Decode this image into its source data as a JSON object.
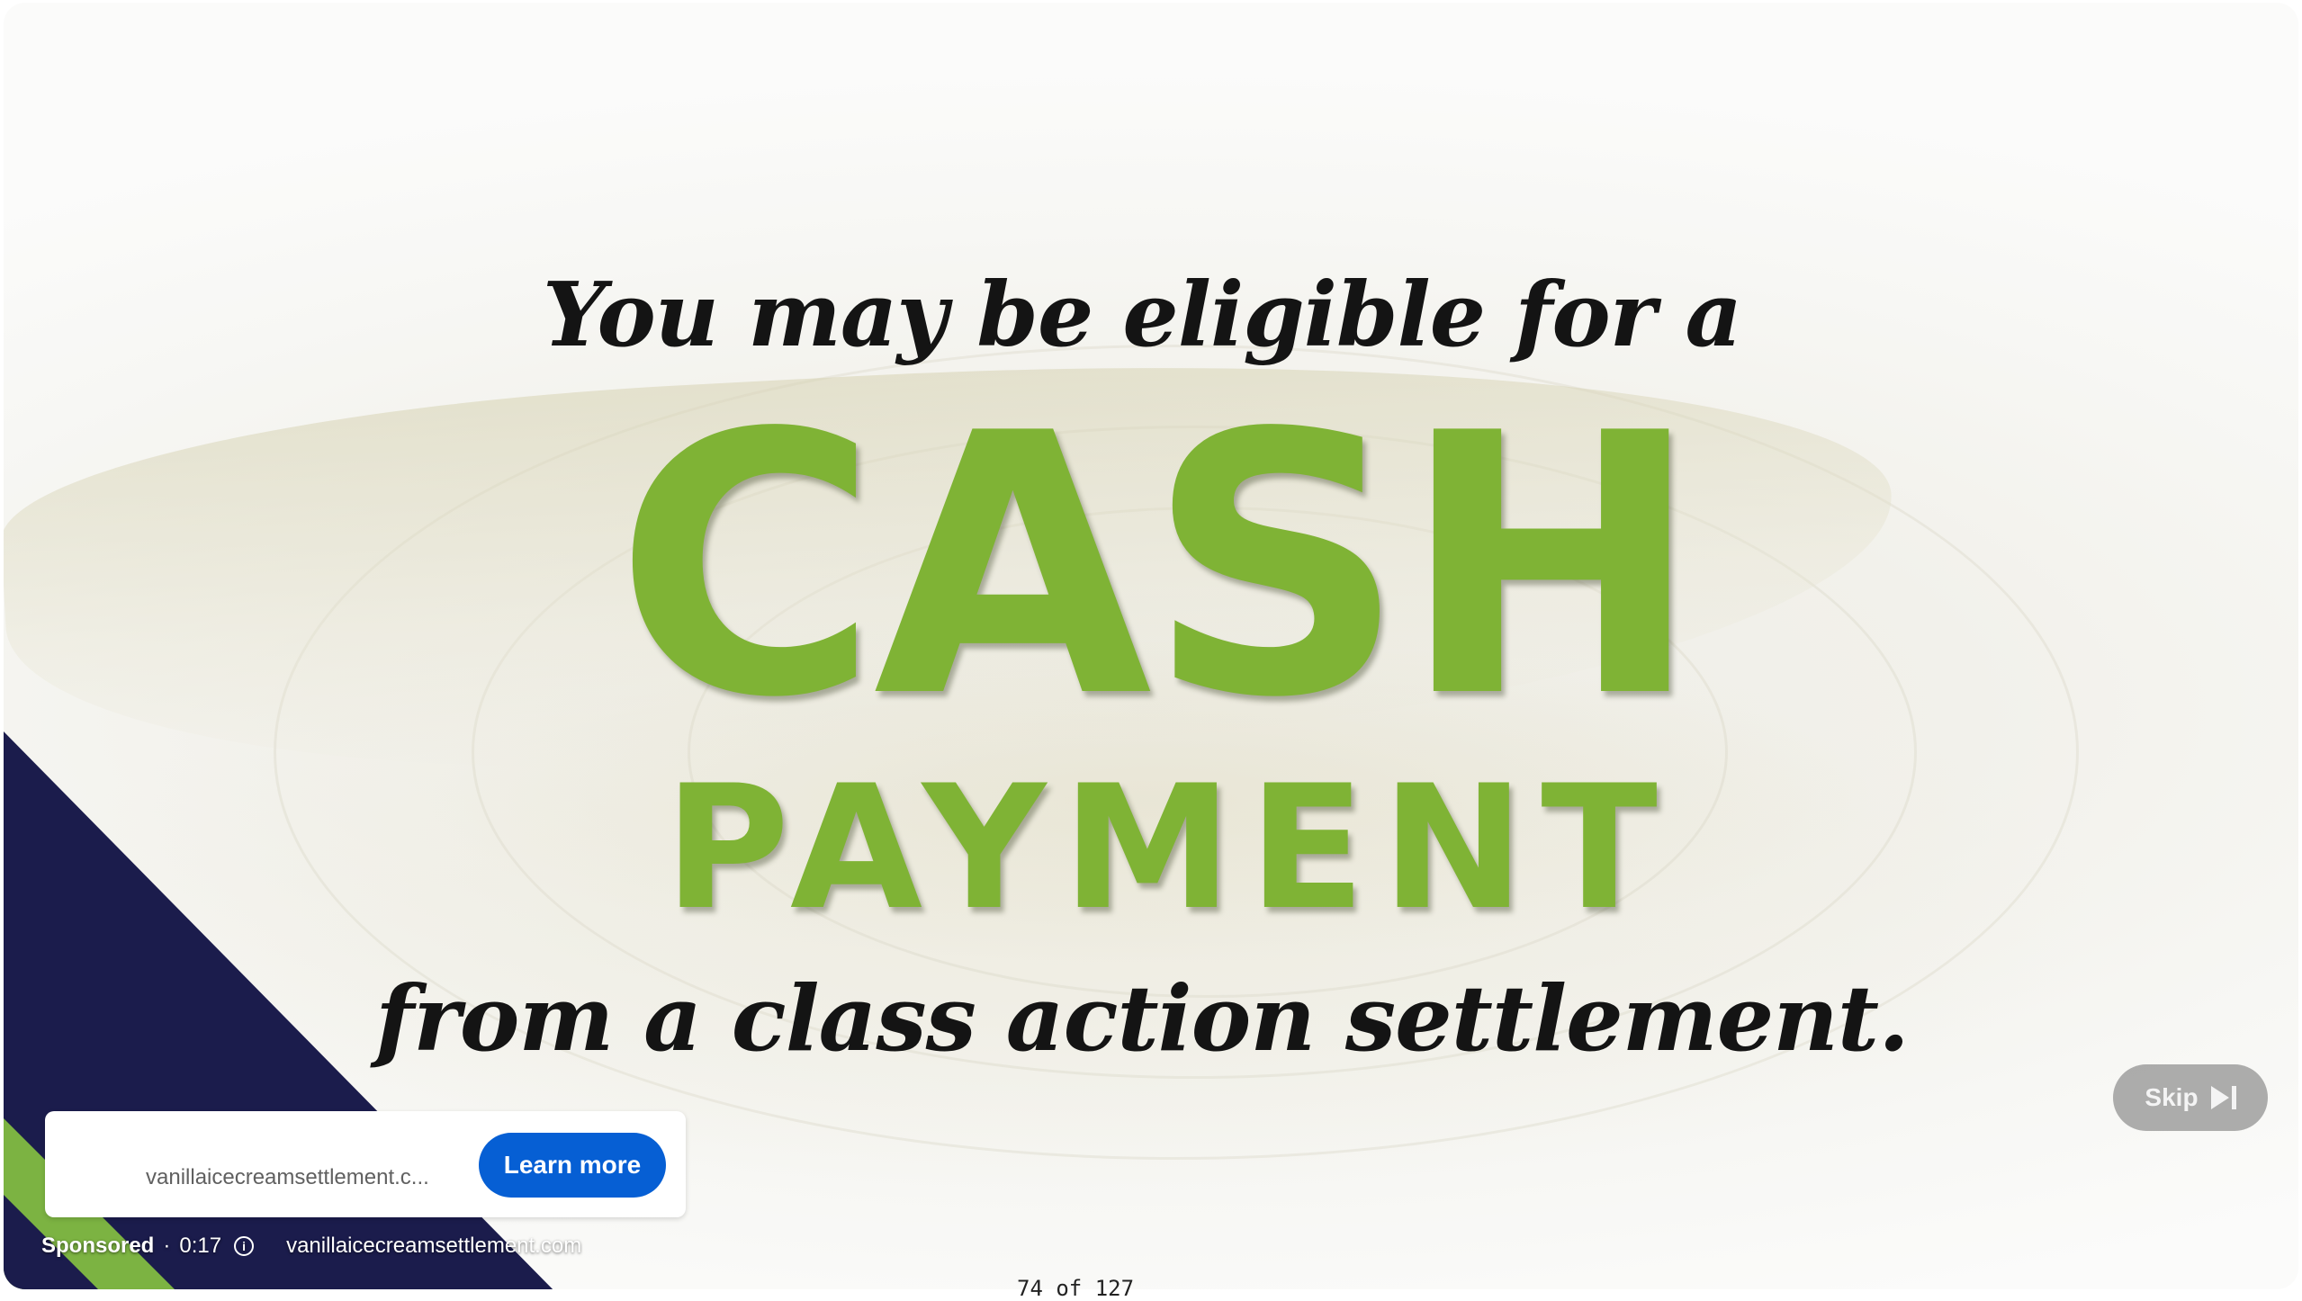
{
  "video_ad": {
    "headline_top": "You may be eligible for a",
    "headline_cash": "CASH",
    "headline_payment": "PAYMENT",
    "headline_bottom": "from a class action settlement.",
    "accent_color": "#7fb335",
    "corner_colors": [
      "#1b1c4c",
      "#7cb342"
    ]
  },
  "ad_card": {
    "url": "vanillaicecreamsettlement.c...",
    "learn_more_label": "Learn more",
    "button_color": "#065fd4"
  },
  "skip": {
    "label": "Skip",
    "icon": "skip-next-icon"
  },
  "ad_info": {
    "sponsored": "Sponsored",
    "separator": "·",
    "time_remaining": "0:17",
    "info_icon": "info-icon",
    "domain": "vanillaicecreamsettlement.com"
  },
  "counter": "74 of 127"
}
